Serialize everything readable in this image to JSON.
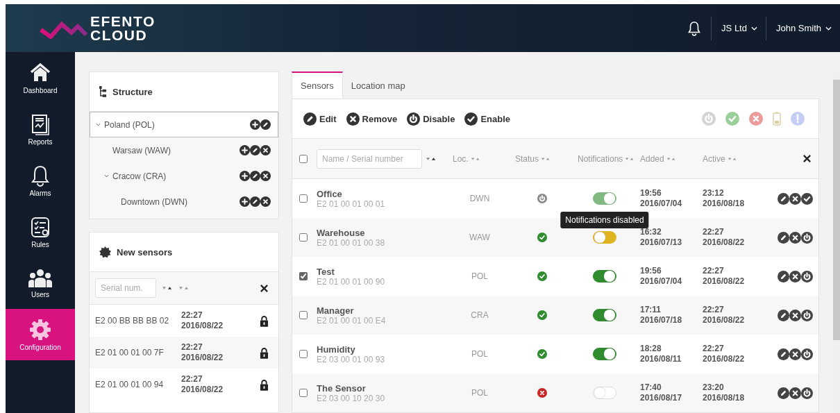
{
  "header": {
    "logo": [
      "EFENTO",
      "CLOUD"
    ],
    "company": "JS Ltd",
    "user": "John Smith"
  },
  "sidebar": {
    "items": [
      {
        "label": "Dashboard",
        "selected": false
      },
      {
        "label": "Reports",
        "selected": false
      },
      {
        "label": "Alarms",
        "selected": false
      },
      {
        "label": "Rules",
        "selected": false
      },
      {
        "label": "Users",
        "selected": false
      },
      {
        "label": "Configuration",
        "selected": true
      }
    ]
  },
  "structure": {
    "title": "Structure",
    "nodes": [
      {
        "label": "Poland (POL)",
        "selected": true,
        "expanded": true,
        "actions": [
          {
            "kind": "add"
          },
          {
            "kind": "edit"
          }
        ],
        "children": [
          {
            "label": "Warsaw (WAW)",
            "selected": false,
            "actions": [
              {
                "kind": "add"
              },
              {
                "kind": "edit"
              },
              {
                "kind": "remove"
              }
            ]
          },
          {
            "label": "Cracow (CRA)",
            "selected": false,
            "expanded": true,
            "actions": [
              {
                "kind": "add"
              },
              {
                "kind": "edit"
              },
              {
                "kind": "remove"
              }
            ],
            "children": [
              {
                "label": "Downtown (DWN)",
                "selected": false,
                "actions": [
                  {
                    "kind": "add"
                  },
                  {
                    "kind": "edit"
                  },
                  {
                    "kind": "remove"
                  }
                ]
              }
            ]
          }
        ]
      }
    ]
  },
  "new_sensors": {
    "title": "New sensors",
    "filter": {
      "placeholder": "Serial num."
    },
    "rows": [
      {
        "serial": "E2 00 BB BB BB 02",
        "time": "22:27",
        "date": "2016/08/22",
        "locked": true
      },
      {
        "serial": "E2 01 00 01 00 7F",
        "time": "22:27",
        "date": "2016/08/22",
        "locked": true
      },
      {
        "serial": "E2 01 00 01 00 94",
        "time": "22:27",
        "date": "2016/08/22",
        "locked": true
      }
    ]
  },
  "tabs": [
    {
      "label": "Sensors",
      "selected": true
    },
    {
      "label": "Location map",
      "selected": false
    }
  ],
  "toolbar": {
    "actions": [
      {
        "kind": "edit",
        "label": "Edit"
      },
      {
        "kind": "remove",
        "label": "Remove"
      },
      {
        "kind": "disable",
        "label": "Disable"
      },
      {
        "kind": "enable",
        "label": "Enable"
      }
    ]
  },
  "table": {
    "select_all": {
      "checked": false
    },
    "search": {
      "placeholder": "Name / Serial number"
    },
    "columns": [
      "Loc.",
      "Status",
      "Notifications",
      "Added",
      "Active"
    ],
    "rows": [
      {
        "checked": false,
        "name": "Office",
        "serial": "E2 01 00 01 00 01",
        "location": "DWN",
        "status": {
          "kind": "disabled"
        },
        "notifications": {
          "kind": "on"
        },
        "added_time": "19:56",
        "added_date": "2016/07/04",
        "active_time": "23:12",
        "active_date": "2016/08/18",
        "actions": [
          {
            "kind": "edit"
          },
          {
            "kind": "remove"
          },
          {
            "kind": "enable"
          }
        ]
      },
      {
        "checked": false,
        "name": "Warehouse",
        "serial": "E2 01 00 01 00 38",
        "location": "WAW",
        "status": {
          "kind": "ok"
        },
        "notifications": {
          "kind": "pending"
        },
        "tooltip": "Notifications disabled",
        "added_time": "16:32",
        "added_date": "2016/07/13",
        "active_time": "22:27",
        "active_date": "2016/08/22",
        "actions": [
          {
            "kind": "edit"
          },
          {
            "kind": "remove"
          },
          {
            "kind": "disable"
          }
        ]
      },
      {
        "checked": true,
        "name": "Test",
        "serial": "E2 01 00 01 00 90",
        "location": "POL",
        "status": {
          "kind": "ok"
        },
        "notifications": {
          "kind": "on"
        },
        "added_time": "19:56",
        "added_date": "2016/07/04",
        "active_time": "22:27",
        "active_date": "2016/08/22",
        "actions": [
          {
            "kind": "edit"
          },
          {
            "kind": "remove"
          },
          {
            "kind": "disable"
          }
        ]
      },
      {
        "checked": false,
        "name": "Manager",
        "serial": "E2 01 00 01 00 E4",
        "location": "CRA",
        "status": {
          "kind": "ok"
        },
        "notifications": {
          "kind": "on"
        },
        "added_time": "17:11",
        "added_date": "2016/07/18",
        "active_time": "22:27",
        "active_date": "2016/08/22",
        "actions": [
          {
            "kind": "edit"
          },
          {
            "kind": "remove"
          },
          {
            "kind": "disable"
          }
        ]
      },
      {
        "checked": false,
        "name": "Humidity",
        "serial": "E2 03 00 01 00 93",
        "location": "POL",
        "status": {
          "kind": "ok"
        },
        "notifications": {
          "kind": "on"
        },
        "added_time": "18:28",
        "added_date": "2016/08/11",
        "active_time": "22:27",
        "active_date": "2016/08/22",
        "actions": [
          {
            "kind": "edit"
          },
          {
            "kind": "remove"
          },
          {
            "kind": "disable"
          }
        ]
      },
      {
        "checked": false,
        "name": "The Sensor",
        "serial": "E2 03 00 10 20 30",
        "location": "POL",
        "status": {
          "kind": "error"
        },
        "notifications": {
          "kind": "off"
        },
        "added_time": "17:40",
        "added_date": "2016/08/17",
        "active_time": "23:20",
        "active_date": "2016/08/18",
        "actions": [
          {
            "kind": "edit"
          },
          {
            "kind": "remove"
          },
          {
            "kind": "disable"
          }
        ]
      }
    ]
  }
}
